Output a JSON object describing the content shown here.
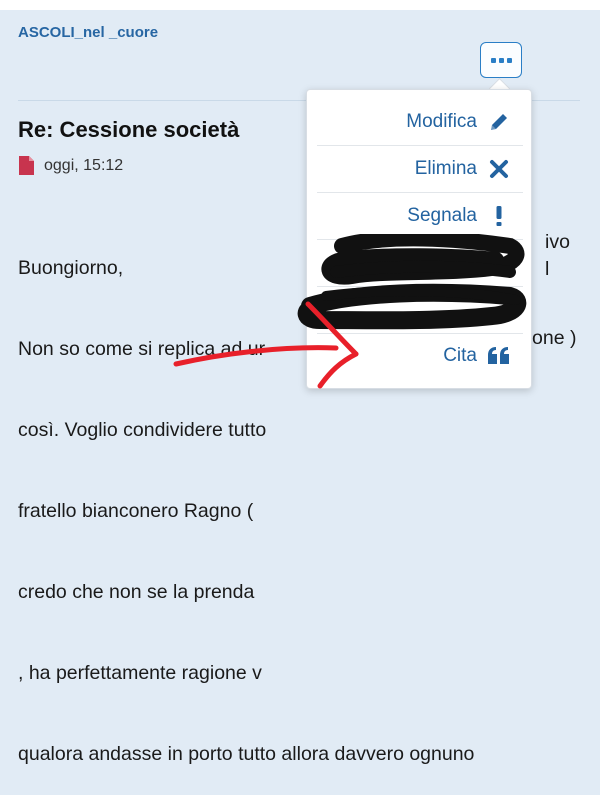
{
  "post": {
    "username": "ASCOLI_nel _cuore",
    "title": "Re: Cessione società",
    "time": "oggi, 15:12",
    "lines": [
      "Buongiorno,",
      "Non so come si replica ad ur",
      "così. Voglio condividere tutto",
      "fratello bianconero Ragno (",
      "credo che non se la prenda",
      ", ha perfettamente ragione v",
      "qualora andasse in porto tutto allora davvero ognuno"
    ],
    "right_fragments": [
      "ivo",
      "l",
      "one )"
    ]
  },
  "menu": {
    "items": [
      {
        "label": "Modifica",
        "icon": "pencil-icon"
      },
      {
        "label": "Elimina",
        "icon": "close-x-icon"
      },
      {
        "label": "Segnala",
        "icon": "exclamation-icon"
      },
      {
        "label": "Cita",
        "icon": "quote-icon"
      }
    ]
  },
  "colors": {
    "background": "#e1ebf5",
    "link": "#2766a3",
    "accent": "#2a7ec6",
    "file_icon": "#c8344e",
    "annotation_red": "#e8202a"
  },
  "icons": {
    "more": "more-dots-icon",
    "file": "file-icon"
  }
}
